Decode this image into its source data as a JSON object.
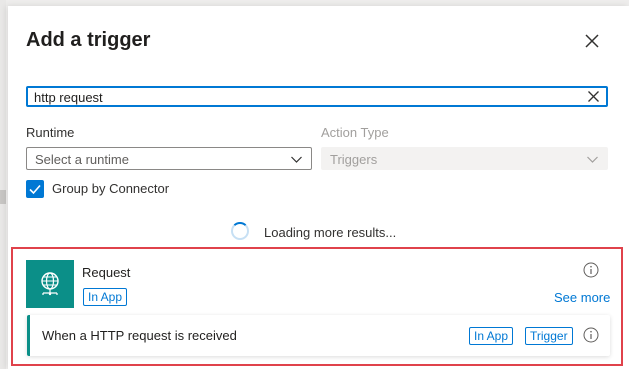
{
  "panel": {
    "title": "Add a trigger"
  },
  "search": {
    "value": "http request"
  },
  "runtime": {
    "label": "Runtime",
    "placeholder": "Select a runtime"
  },
  "action_type": {
    "label": "Action Type",
    "value": "Triggers"
  },
  "group_by": {
    "label": "Group by Connector",
    "checked": true
  },
  "loading": {
    "text": "Loading more results..."
  },
  "connector": {
    "name": "Request",
    "badge": "In App",
    "see_more": "See more",
    "icon": "globe-icon",
    "icon_color": "#0b8f88"
  },
  "action": {
    "name": "When a HTTP request is received",
    "badges": [
      "In App",
      "Trigger"
    ]
  },
  "colors": {
    "accent": "#0078d4",
    "highlight": "#e0424b"
  }
}
